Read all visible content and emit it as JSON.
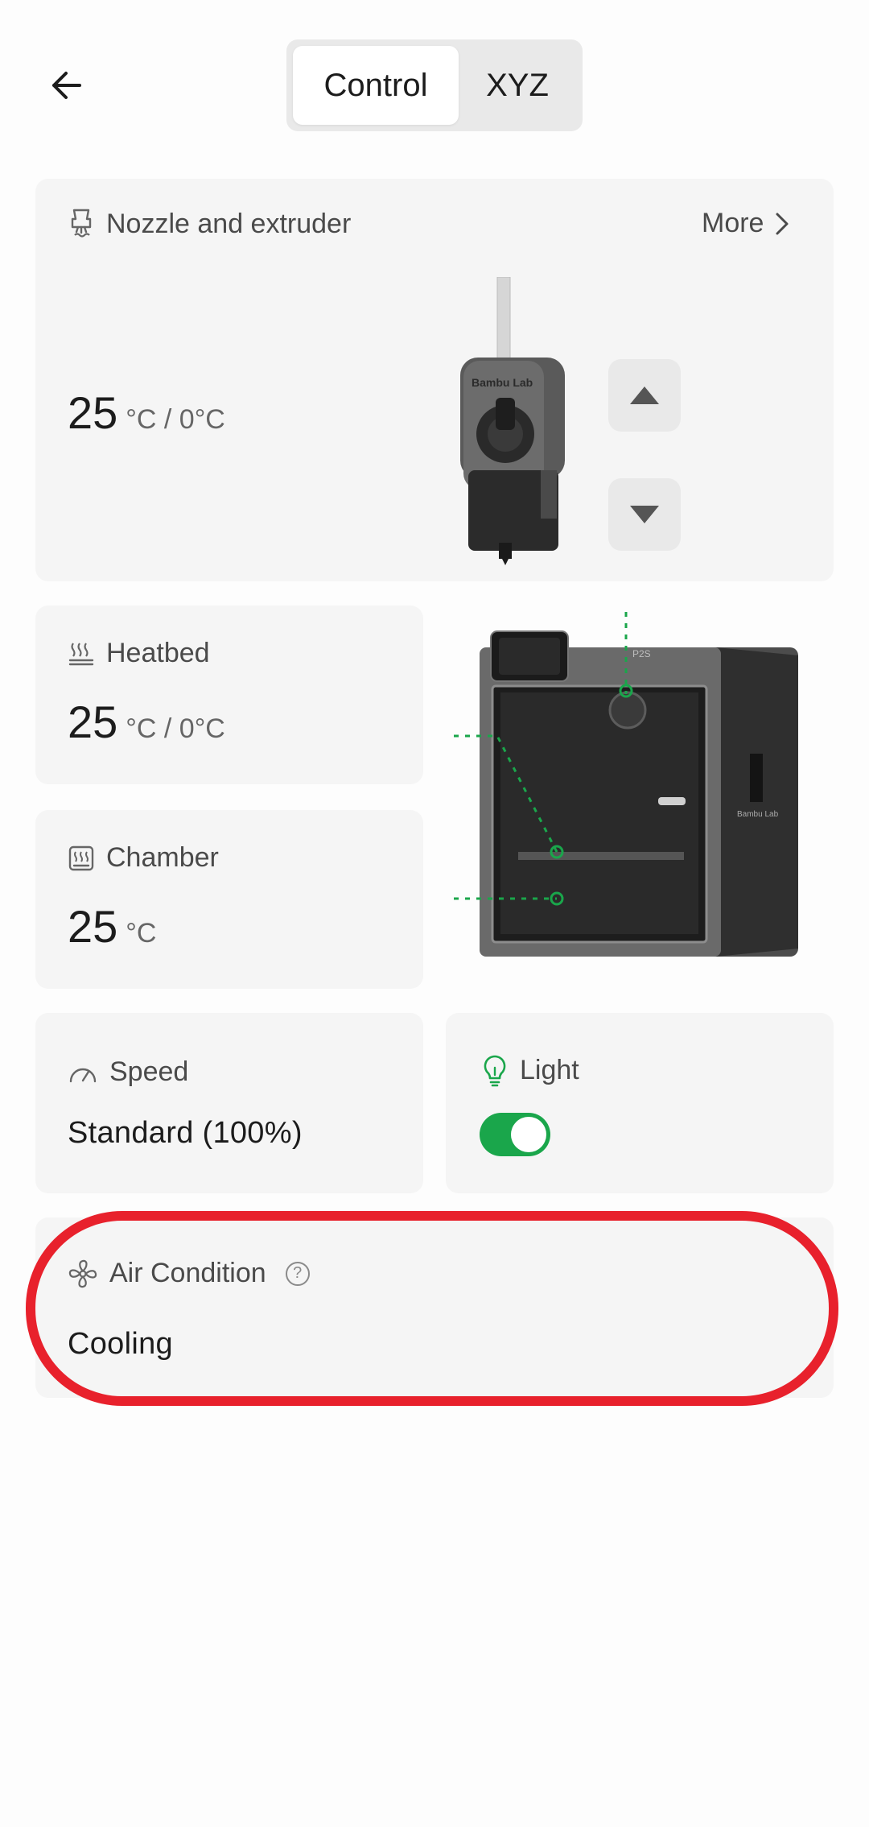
{
  "header": {
    "tabs": [
      {
        "label": "Control",
        "active": true
      },
      {
        "label": "XYZ",
        "active": false
      }
    ]
  },
  "nozzle": {
    "title": "Nozzle and extruder",
    "more_label": "More",
    "temp": "25",
    "unit": "°C / 0°C",
    "image_brand": "Bambu Lab"
  },
  "heatbed": {
    "title": "Heatbed",
    "temp": "25",
    "unit": "°C / 0°C"
  },
  "chamber": {
    "title": "Chamber",
    "temp": "25",
    "unit": "°C"
  },
  "printer": {
    "model": "P2S",
    "brand": "Bambu Lab"
  },
  "speed": {
    "title": "Speed",
    "value": "Standard (100%)"
  },
  "light": {
    "title": "Light",
    "on": true
  },
  "air_condition": {
    "title": "Air Condition",
    "value": "Cooling"
  },
  "colors": {
    "accent_green": "#1aa64b",
    "highlight_red": "#e8212c",
    "card_bg": "#f5f5f5"
  }
}
